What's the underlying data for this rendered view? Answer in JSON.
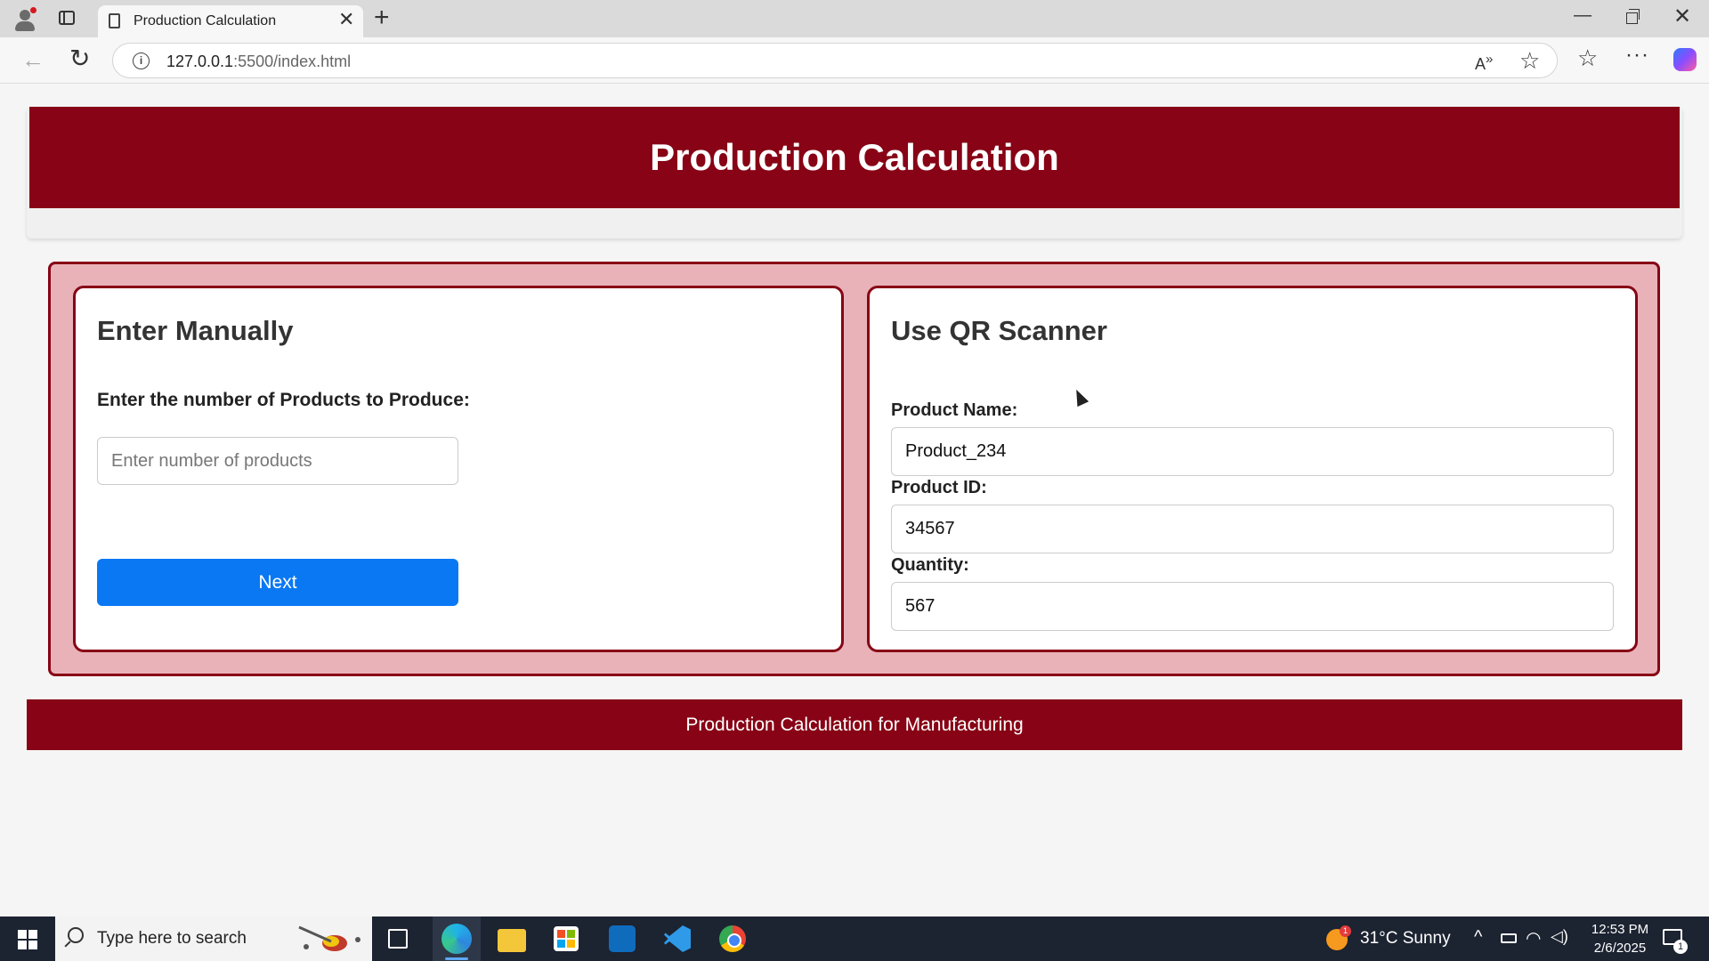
{
  "browser": {
    "tab_title": "Production Calculation",
    "url_host": "127.0.0.1",
    "url_rest": ":5500/index.html"
  },
  "page": {
    "title": "Production Calculation",
    "manual": {
      "heading": "Enter Manually",
      "count_label": "Enter the number of Products to Produce:",
      "count_placeholder": "Enter number of products",
      "next_label": "Next"
    },
    "qr": {
      "heading": "Use QR Scanner",
      "product_name_label": "Product Name:",
      "product_name_value": "Product_234",
      "product_id_label": "Product ID:",
      "product_id_value": "34567",
      "quantity_label": "Quantity:",
      "quantity_value": "567"
    },
    "footer": "Production Calculation for Manufacturing"
  },
  "taskbar": {
    "search_placeholder": "Type here to search",
    "weather": "31°C  Sunny",
    "weather_badge": "1",
    "time": "12:53 PM",
    "date": "2/6/2025",
    "notification_count": "1"
  },
  "colors": {
    "brand": "#870315",
    "panel": "#e8b2b8",
    "button": "#0a78f2"
  }
}
